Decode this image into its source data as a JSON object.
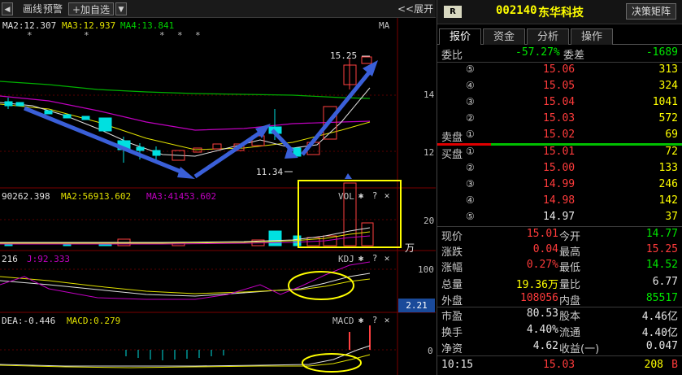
{
  "toolbar": {
    "arrow_left": "◀",
    "draw_label": "画线",
    "warn_label": "预警",
    "add_watch_label": "+加自选",
    "dropdown": "▼",
    "expand_label": "<<展开"
  },
  "main_chart": {
    "ma2": "MA2:12.307",
    "ma3": "MA3:12.937",
    "ma4": "MA4:13.841",
    "stars": [
      "*",
      "*",
      "*",
      "*",
      "*"
    ],
    "ma_tag": "MA",
    "high_label": "15.25",
    "low_label": "11.34",
    "y_labels": [
      "14",
      "12"
    ]
  },
  "vol_chart": {
    "ma1": "90262.398",
    "ma2": "MA2:56913.602",
    "ma3": "MA3:41453.602",
    "tag": "VOL",
    "y_label": "20",
    "unit": "万"
  },
  "kdj_chart": {
    "left_val": "216",
    "j_val": "J:92.333",
    "tag": "KDJ",
    "y_label": "100",
    "badge": "2.21"
  },
  "macd_chart": {
    "dea": "DEA:-0.446",
    "macd": "MACD:0.279",
    "tag": "MACD",
    "y_label": "0"
  },
  "panel_icons": {
    "gear": "✱",
    "help": "?",
    "close": "✕"
  },
  "quote": {
    "badge": "R",
    "code": "002140",
    "name": "东华科技",
    "decision_btn": "决策矩阵",
    "tabs": [
      "报价",
      "资金",
      "分析",
      "操作"
    ],
    "weibi_label": "委比",
    "weibi_val": "-57.27%",
    "weicha_label": "委差",
    "weicha_val": "-1689",
    "sell_label": "卖盘",
    "buy_label": "买盘",
    "sells": [
      {
        "idx": "⑤",
        "price": "15.06",
        "vol": "313"
      },
      {
        "idx": "④",
        "price": "15.05",
        "vol": "324"
      },
      {
        "idx": "③",
        "price": "15.04",
        "vol": "1041"
      },
      {
        "idx": "②",
        "price": "15.03",
        "vol": "572"
      },
      {
        "idx": "①",
        "price": "15.02",
        "vol": "69"
      }
    ],
    "buys": [
      {
        "idx": "①",
        "price": "15.01",
        "vol": "72"
      },
      {
        "idx": "②",
        "price": "15.00",
        "vol": "133"
      },
      {
        "idx": "③",
        "price": "14.99",
        "vol": "246"
      },
      {
        "idx": "④",
        "price": "14.98",
        "vol": "142"
      },
      {
        "idx": "⑤",
        "price": "14.97",
        "vol": "37"
      }
    ],
    "stats": [
      {
        "l1": "现价",
        "v1": "15.01",
        "l2": "今开",
        "v2": "14.77"
      },
      {
        "l1": "涨跌",
        "v1": "0.04",
        "l2": "最高",
        "v2": "15.25"
      },
      {
        "l1": "涨幅",
        "v1": "0.27%",
        "l2": "最低",
        "v2": "14.52"
      },
      {
        "l1": "总量",
        "v1": "19.36万",
        "l2": "量比",
        "v2": "6.77"
      },
      {
        "l1": "外盘",
        "v1": "108056",
        "l2": "内盘",
        "v2": "85517"
      },
      {
        "l1": "市盈",
        "v1": "80.53",
        "l2": "股本",
        "v2": "4.46亿"
      },
      {
        "l1": "换手",
        "v1": "4.40%",
        "l2": "流通",
        "v2": "4.40亿"
      },
      {
        "l1": "净资",
        "v1": "4.62",
        "l2": "收益(一)",
        "v2": "0.047"
      }
    ],
    "tick": {
      "time": "10:15",
      "price": "15.03",
      "vol": "208",
      "dir": "B"
    }
  }
}
